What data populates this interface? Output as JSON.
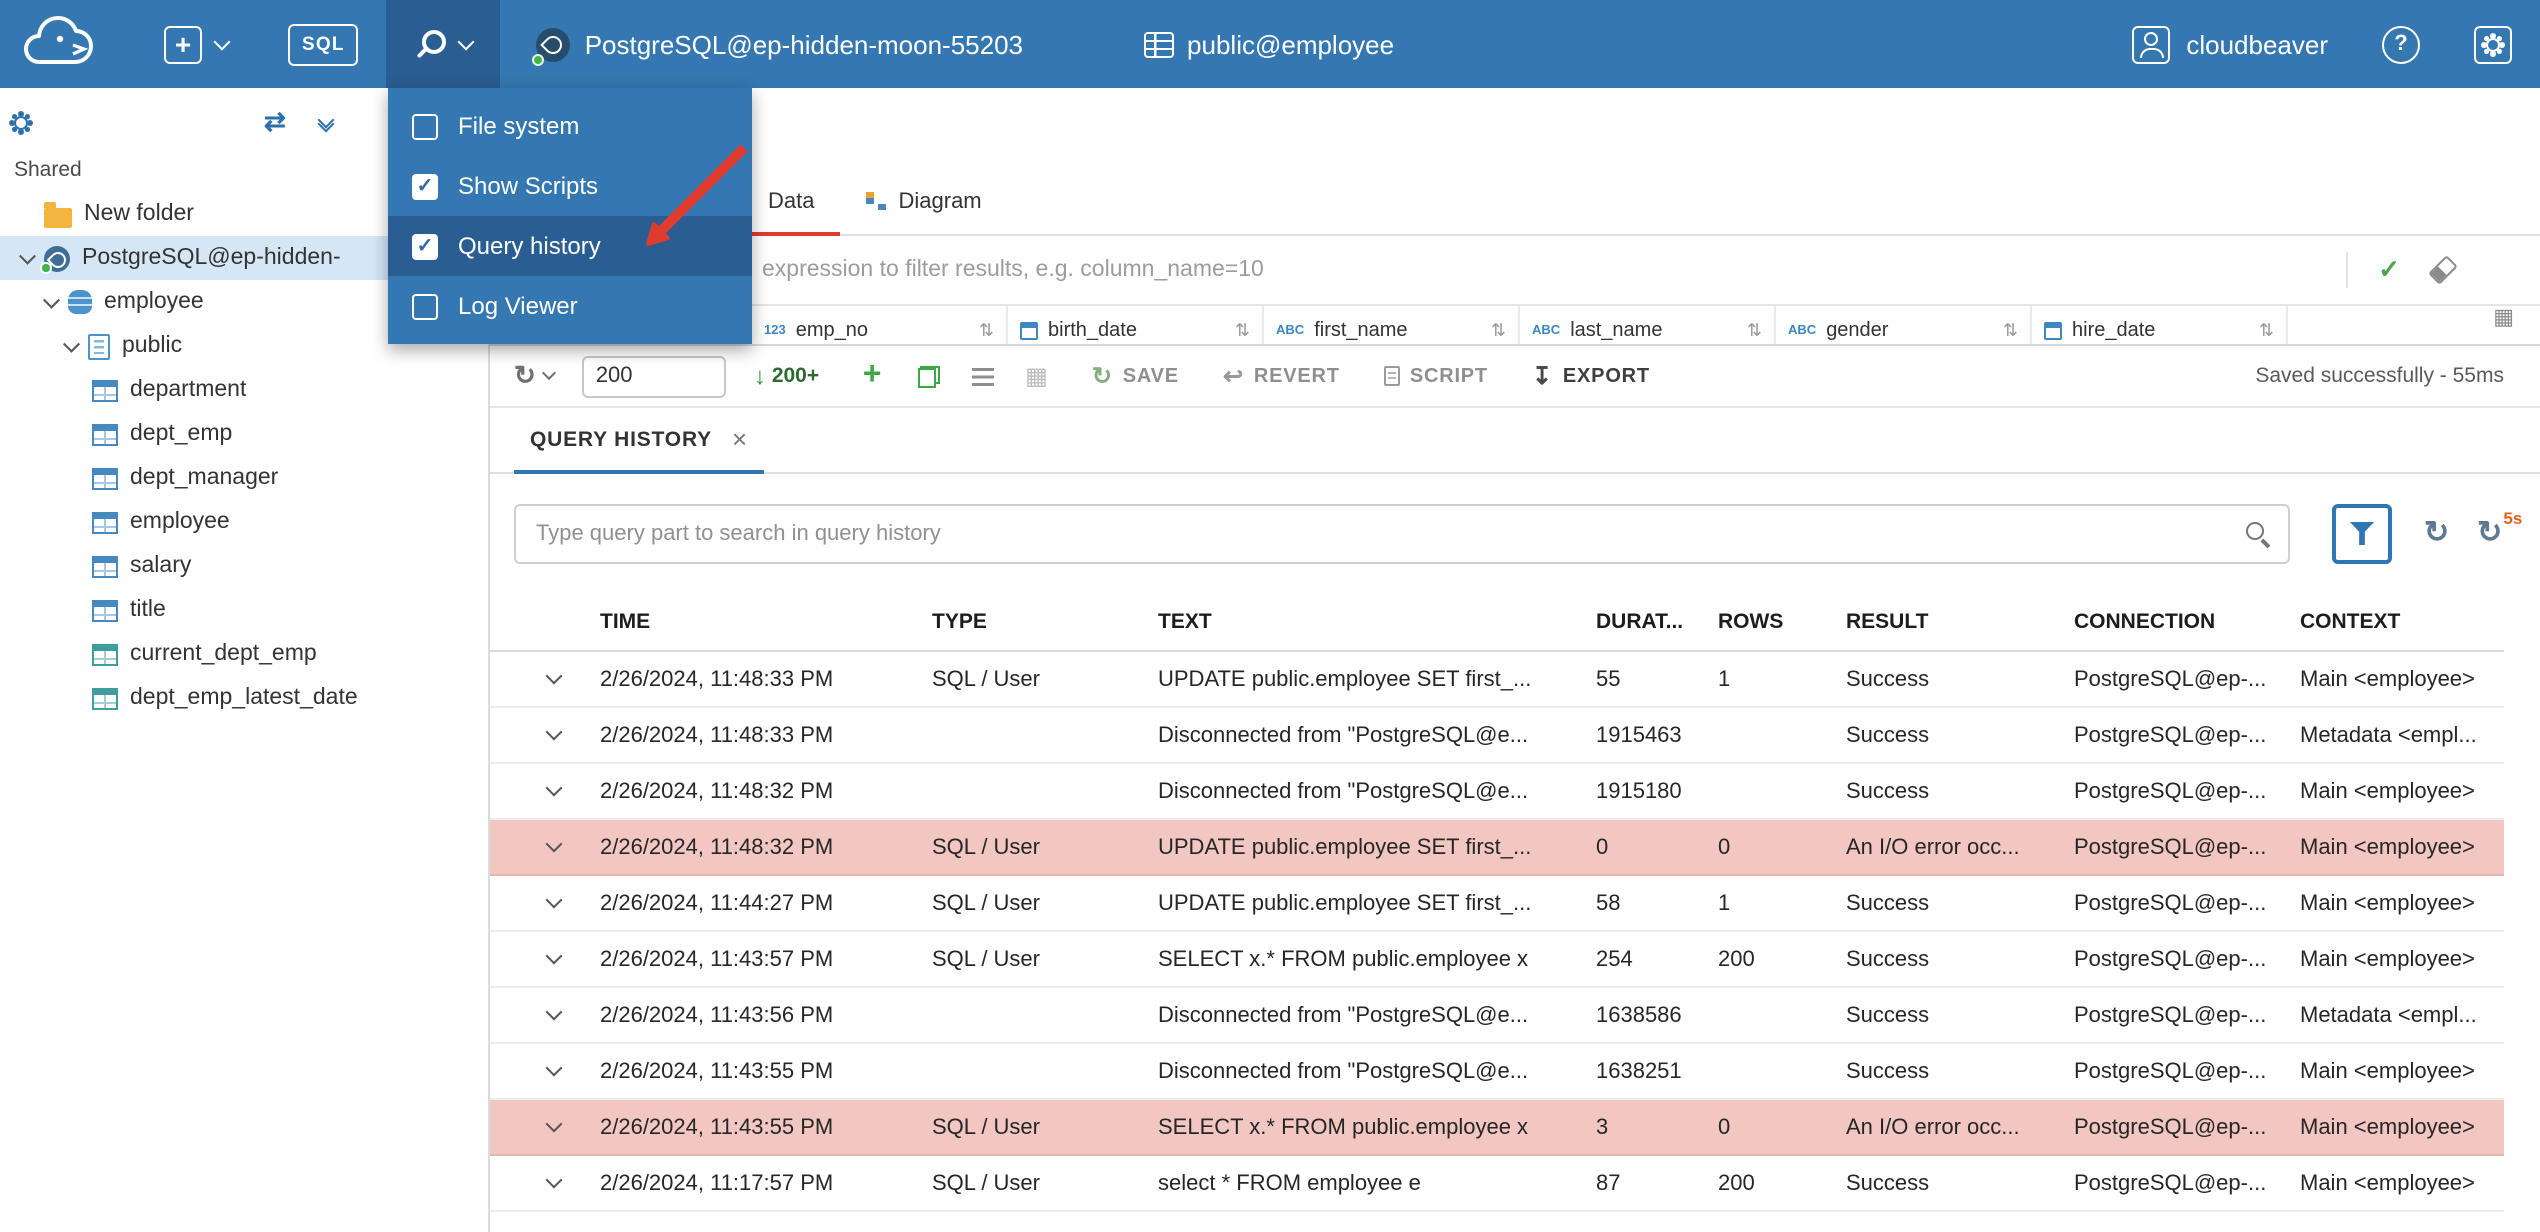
{
  "topbar": {
    "sql_button": "SQL",
    "connection_label": "PostgreSQL@ep-hidden-moon-55203",
    "schema_label": "public@employee",
    "username": "cloudbeaver"
  },
  "tools_menu": {
    "items": [
      {
        "label": "File system",
        "checked": false,
        "highlighted": false
      },
      {
        "label": "Show Scripts",
        "checked": true,
        "highlighted": false
      },
      {
        "label": "Query history",
        "checked": true,
        "highlighted": true
      },
      {
        "label": "Log Viewer",
        "checked": false,
        "highlighted": false
      }
    ]
  },
  "sidebar": {
    "section_label": "Shared",
    "tree": [
      {
        "label": "New folder",
        "icon": "folder",
        "level": 0,
        "chevron": "space",
        "selected": false
      },
      {
        "label": "PostgreSQL@ep-hidden-",
        "icon": "postgres",
        "level": 0,
        "chevron": "down",
        "selected": true
      },
      {
        "label": "employee",
        "icon": "database",
        "level": 1,
        "chevron": "down",
        "selected": false
      },
      {
        "label": "public",
        "icon": "schema",
        "level": 2,
        "chevron": "down",
        "selected": false
      },
      {
        "label": "department",
        "icon": "table",
        "level": 3,
        "chevron": "none",
        "selected": false
      },
      {
        "label": "dept_emp",
        "icon": "table",
        "level": 3,
        "chevron": "none",
        "selected": false
      },
      {
        "label": "dept_manager",
        "icon": "table",
        "level": 3,
        "chevron": "none",
        "selected": false
      },
      {
        "label": "employee",
        "icon": "table",
        "level": 3,
        "chevron": "none",
        "selected": false
      },
      {
        "label": "salary",
        "icon": "table",
        "level": 3,
        "chevron": "none",
        "selected": false
      },
      {
        "label": "title",
        "icon": "table",
        "level": 3,
        "chevron": "none",
        "selected": false
      },
      {
        "label": "current_dept_emp",
        "icon": "view",
        "level": 3,
        "chevron": "none",
        "selected": false
      },
      {
        "label": "dept_emp_latest_date",
        "icon": "view",
        "level": 3,
        "chevron": "none",
        "selected": false
      }
    ]
  },
  "editor": {
    "tabs": [
      {
        "label": "Data",
        "active": true,
        "icon": null
      },
      {
        "label": "Diagram",
        "active": false,
        "icon": "diagram"
      }
    ],
    "filter_text": "expression to filter results, e.g. column_name=10",
    "columns": [
      {
        "name": "emp_no",
        "type": "number"
      },
      {
        "name": "birth_date",
        "type": "date"
      },
      {
        "name": "first_name",
        "type": "text"
      },
      {
        "name": "last_name",
        "type": "text"
      },
      {
        "name": "gender",
        "type": "text"
      },
      {
        "name": "hire_date",
        "type": "date"
      }
    ],
    "toolbar": {
      "row_limit": "200",
      "fetch_more": "200+",
      "save_label": "SAVE",
      "revert_label": "REVERT",
      "script_label": "SCRIPT",
      "export_label": "EXPORT",
      "status": "Saved successfully - 55ms"
    }
  },
  "query_history": {
    "tab_label": "QUERY HISTORY",
    "search_placeholder": "Type query part to search in query history",
    "auto_refresh_badge": "5s",
    "columns": [
      "TIME",
      "TYPE",
      "TEXT",
      "DURAT...",
      "ROWS",
      "RESULT",
      "CONNECTION",
      "CONTEXT"
    ],
    "rows": [
      {
        "time": "2/26/2024, 11:48:33 PM",
        "type": "SQL / User",
        "text": "UPDATE public.employee SET first_...",
        "duration": "55",
        "rows": "1",
        "result": "Success",
        "connection": "PostgreSQL@ep-...",
        "context": "Main <employee>",
        "error": false
      },
      {
        "time": "2/26/2024, 11:48:33 PM",
        "type": "",
        "text": "Disconnected from \"PostgreSQL@e...",
        "duration": "1915463",
        "rows": "",
        "result": "Success",
        "connection": "PostgreSQL@ep-...",
        "context": "Metadata <empl...",
        "error": false
      },
      {
        "time": "2/26/2024, 11:48:32 PM",
        "type": "",
        "text": "Disconnected from \"PostgreSQL@e...",
        "duration": "1915180",
        "rows": "",
        "result": "Success",
        "connection": "PostgreSQL@ep-...",
        "context": "Main <employee>",
        "error": false
      },
      {
        "time": "2/26/2024, 11:48:32 PM",
        "type": "SQL / User",
        "text": "UPDATE public.employee SET first_...",
        "duration": "0",
        "rows": "0",
        "result": "An I/O error occ...",
        "connection": "PostgreSQL@ep-...",
        "context": "Main <employee>",
        "error": true
      },
      {
        "time": "2/26/2024, 11:44:27 PM",
        "type": "SQL / User",
        "text": "UPDATE public.employee SET first_...",
        "duration": "58",
        "rows": "1",
        "result": "Success",
        "connection": "PostgreSQL@ep-...",
        "context": "Main <employee>",
        "error": false
      },
      {
        "time": "2/26/2024, 11:43:57 PM",
        "type": "SQL / User",
        "text": "SELECT x.* FROM public.employee x",
        "duration": "254",
        "rows": "200",
        "result": "Success",
        "connection": "PostgreSQL@ep-...",
        "context": "Main <employee>",
        "error": false
      },
      {
        "time": "2/26/2024, 11:43:56 PM",
        "type": "",
        "text": "Disconnected from \"PostgreSQL@e...",
        "duration": "1638586",
        "rows": "",
        "result": "Success",
        "connection": "PostgreSQL@ep-...",
        "context": "Metadata <empl...",
        "error": false
      },
      {
        "time": "2/26/2024, 11:43:55 PM",
        "type": "",
        "text": "Disconnected from \"PostgreSQL@e...",
        "duration": "1638251",
        "rows": "",
        "result": "Success",
        "connection": "PostgreSQL@ep-...",
        "context": "Main <employee>",
        "error": false
      },
      {
        "time": "2/26/2024, 11:43:55 PM",
        "type": "SQL / User",
        "text": "SELECT x.* FROM public.employee x",
        "duration": "3",
        "rows": "0",
        "result": "An I/O error occ...",
        "connection": "PostgreSQL@ep-...",
        "context": "Main <employee>",
        "error": true
      },
      {
        "time": "2/26/2024, 11:17:57 PM",
        "type": "SQL / User",
        "text": "select * FROM employee e",
        "duration": "87",
        "rows": "200",
        "result": "Success",
        "connection": "PostgreSQL@ep-...",
        "context": "Main <employee>",
        "error": false
      }
    ]
  },
  "colors": {
    "topbar_bg": "#3577b1",
    "menu_highlight_bg": "#2a5d92",
    "active_tab_red": "#e03c2e",
    "query_history_accent_blue": "#2f76b5",
    "error_row_bg": "#f2c7c2",
    "connected_status_green": "#43b649",
    "annotation_arrow_red": "#e03c2e"
  }
}
